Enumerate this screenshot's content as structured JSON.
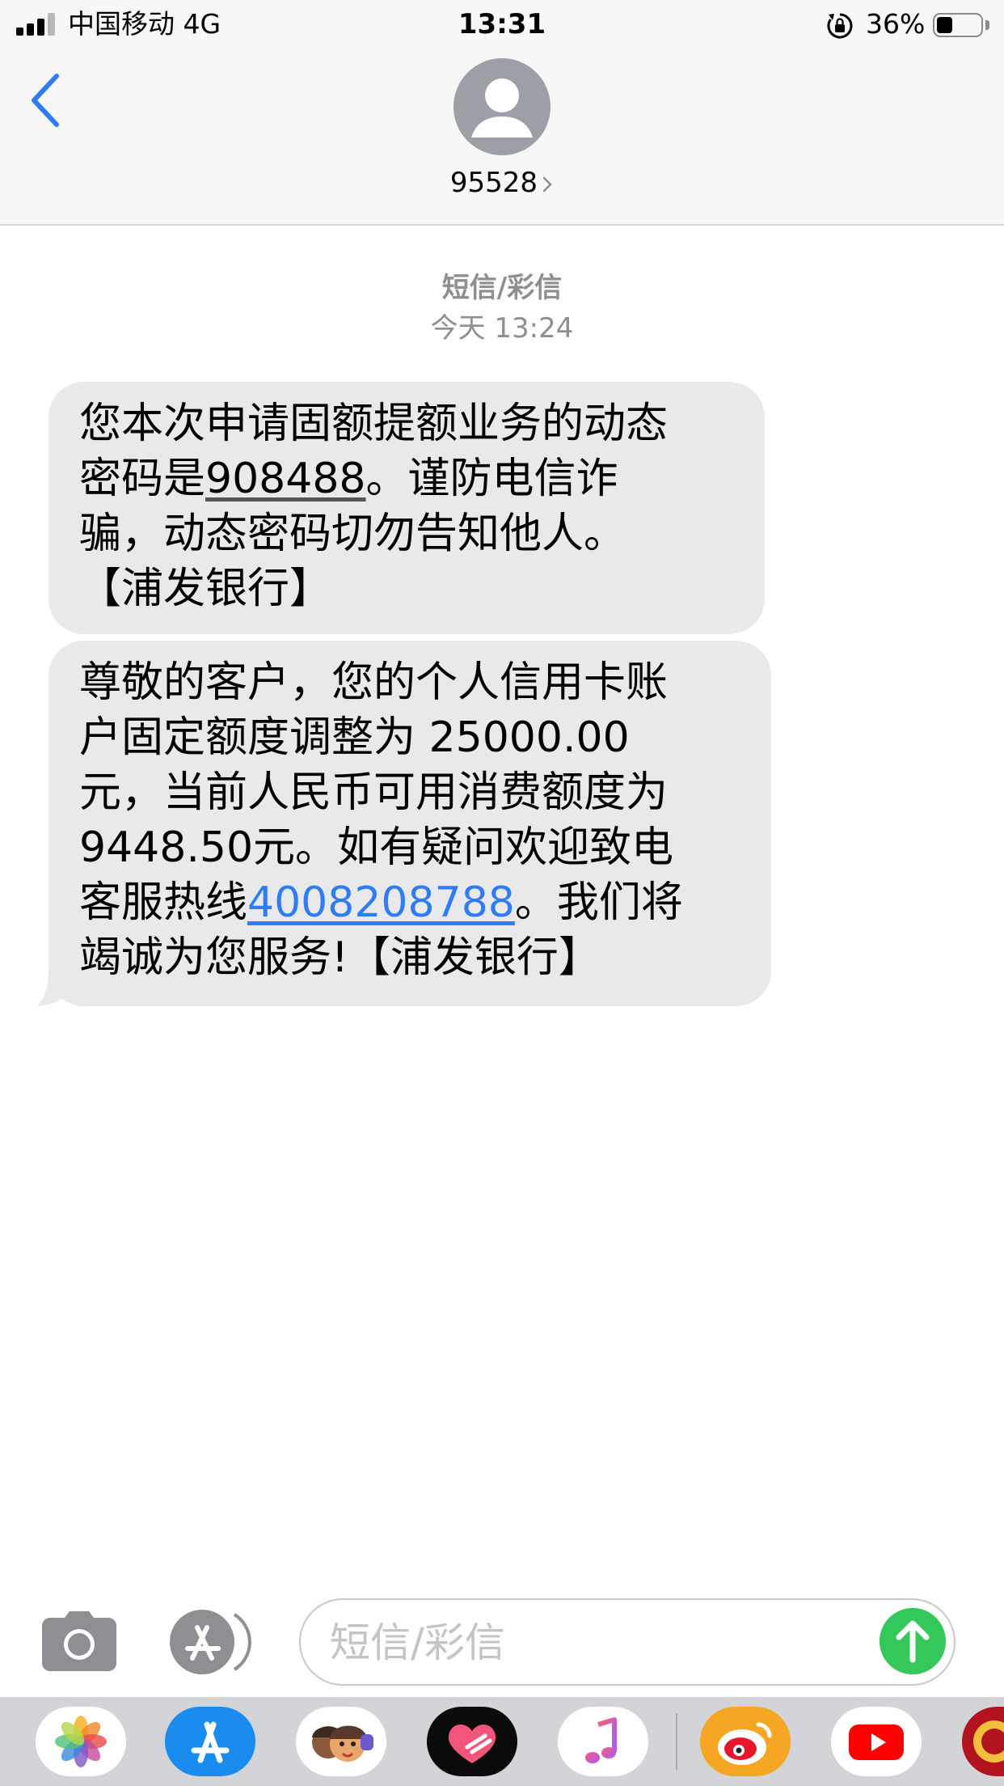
{
  "status_bar": {
    "carrier": "中国移动  4G",
    "time": "13:31",
    "battery_percent": "36%",
    "battery_level": 0.36,
    "signal_bars": 3
  },
  "header": {
    "contact": "95528"
  },
  "conversation": {
    "message_type": "短信/彩信",
    "timestamp": "今天 13:24",
    "messages": [
      {
        "line1": "您本次申请固额提额业务的动态",
        "line2_pre": "密码是",
        "otp": "908488",
        "line2_post": "。谨防电信诈",
        "line3": "骗，动态密码切勿告知他人。",
        "line4": "【浦发银行】"
      },
      {
        "line1": "尊敬的客户，您的个人信用卡账",
        "line2": "户固定额度调整为 25000.00",
        "line3": "元，当前人民币可用消费额度为",
        "line4": "9448.50元。如有疑问欢迎致电",
        "line5_pre": "客服热线",
        "phone": "4008208788",
        "line5_post": "。我们将",
        "line6": "竭诚为您服务!【浦发银行】"
      }
    ]
  },
  "input_bar": {
    "placeholder": "短信/彩信"
  },
  "app_drawer": {
    "apps": [
      "photos-icon",
      "app-store-icon",
      "memoji-icon",
      "digital-touch-icon",
      "music-icon",
      "weibo-icon",
      "youtube-icon",
      "partial-app-icon"
    ]
  },
  "colors": {
    "bubble_gray": "#e9e9eb",
    "link_blue": "#2e7cf6",
    "send_green": "#34c759",
    "meta_gray": "#8e8e93"
  }
}
